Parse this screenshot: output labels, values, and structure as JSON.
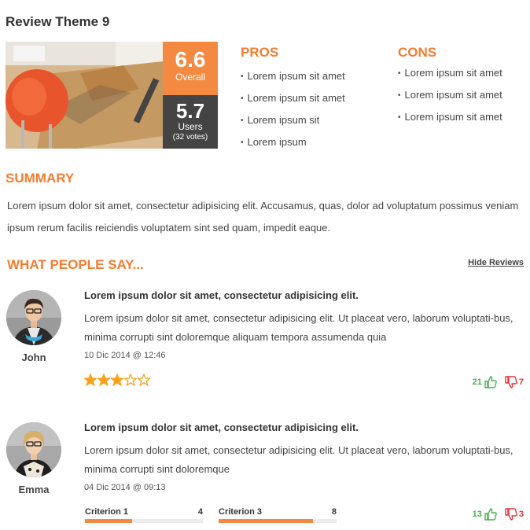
{
  "page_title": "Review Theme 9",
  "scores": {
    "overall_value": "6.6",
    "overall_label": "Overall",
    "users_value": "5.7",
    "users_label": "Users",
    "users_votes": "(32 votes)"
  },
  "pros": {
    "heading": "PROS",
    "items": [
      "Lorem ipsum sit amet",
      "Lorem ipsum sit amet",
      "Lorem ipsum sit",
      "Lorem ipsum"
    ]
  },
  "cons": {
    "heading": "CONS",
    "items": [
      "Lorem ipsum sit amet",
      "Lorem ipsum sit amet",
      "Lorem ipsum sit amet"
    ]
  },
  "summary": {
    "heading": "SUMMARY",
    "text": "Lorem ipsum dolor sit amet, consectetur adipisicing elit. Accusamus, quas, dolor ad voluptatum possimus veniam ipsum rerum facilis reiciendis voluptatem sint sed quam, impedit eaque."
  },
  "reviews_section": {
    "heading": "WHAT PEOPLE SAY...",
    "hide_label": "Hide Reviews"
  },
  "reviews": [
    {
      "name": "John",
      "title": "Lorem ipsum dolor sit amet, consectetur adipisicing elit.",
      "body": "Lorem ipsum dolor sit amet, consectetur adipisicing elit. Ut placeat vero, laborum voluptati-bus, minima corrupti sint doloremque aliquam tempora assumenda quia",
      "date": "10 Dic 2014 @ 12:46",
      "rating": 3,
      "rating_max": 5,
      "upvotes": "21",
      "downvotes": "7"
    },
    {
      "name": "Emma",
      "title": "Lorem ipsum dolor sit amet, consectetur adipisicing elit.",
      "body": "Lorem ipsum dolor sit amet, consectetur adipisicing elit. Ut placeat vero, laborum voluptati-bus, minima corrupti sint doloremque",
      "date": "04 Dic 2014 @ 09:13",
      "criteria": [
        {
          "label": "Criterion 1",
          "value": "4",
          "fraction": 0.4
        },
        {
          "label": "Criterion 3",
          "value": "8",
          "fraction": 0.8
        }
      ],
      "upvotes": "13",
      "downvotes": "3"
    }
  ],
  "colors": {
    "accent": "#f48a42",
    "dark": "#444444",
    "upvote": "#4caf50",
    "downvote": "#e0353a",
    "star": "#f7a21c"
  },
  "icons": {
    "thumb_up": "thumbs-up-icon",
    "thumb_down": "thumbs-down-icon",
    "star": "star-icon"
  }
}
